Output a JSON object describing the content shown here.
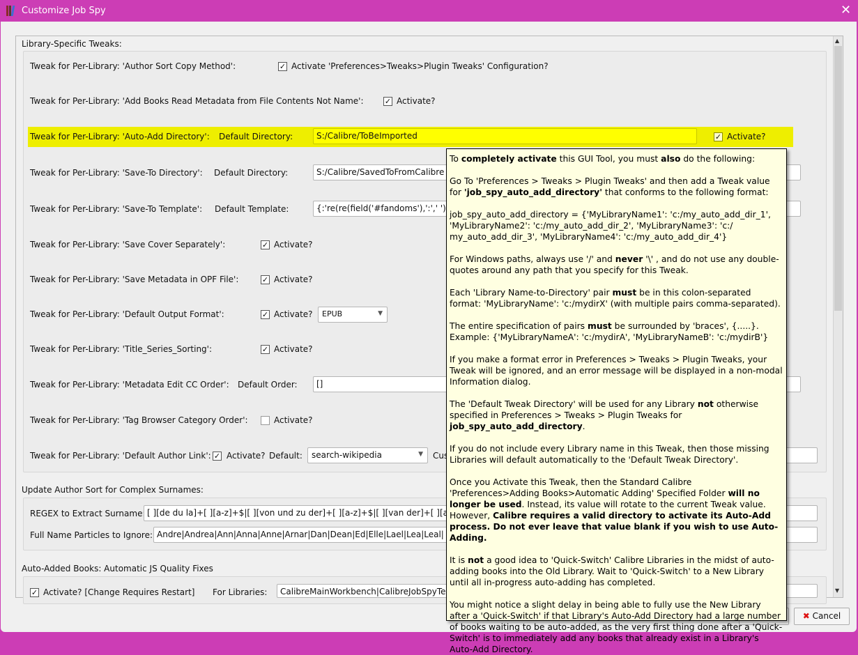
{
  "window": {
    "title": "Customize Job Spy",
    "close": "✕"
  },
  "sections": {
    "library": "Library-Specific Tweaks:",
    "author_sort": "Update Author Sort for Complex Surnames:",
    "auto_added": "Auto-Added Books: Automatic JS Quality Fixes"
  },
  "rows": {
    "author_sort_copy": {
      "label": "Tweak for Per-Library: 'Author Sort Copy Method':",
      "checkbox": "Activate 'Preferences>Tweaks>Plugin Tweaks' Configuration?",
      "checked": true
    },
    "read_metadata": {
      "label": "Tweak for Per-Library: 'Add Books Read Metadata from File Contents Not Name':",
      "checkbox": "Activate?",
      "checked": true
    },
    "auto_add": {
      "label": "Tweak for Per-Library: 'Auto-Add Directory':",
      "field_label": "Default Directory:",
      "value": "S:/Calibre/ToBeImported",
      "checkbox": "Activate?",
      "checked": true,
      "highlight": "#eeee00"
    },
    "save_to_dir": {
      "label": "Tweak for Per-Library: 'Save-To Directory':",
      "field_label": "Default Directory:",
      "value": "S:/Calibre/SavedToFromCalibre"
    },
    "save_to_template": {
      "label": "Tweak for Per-Library: 'Save-To Template':",
      "field_label": "Default Template:",
      "value": "{:'re(re(field('#fandoms'),':',' '),'"
    },
    "save_cover": {
      "label": "Tweak for Per-Library: 'Save Cover Separately':",
      "checkbox": "Activate?",
      "checked": true
    },
    "save_opf": {
      "label": "Tweak for Per-Library: 'Save Metadata in OPF File':",
      "checkbox": "Activate?",
      "checked": true
    },
    "output_format": {
      "label": "Tweak for Per-Library: 'Default Output Format':",
      "checkbox": "Activate?",
      "checked": true,
      "select": "EPUB"
    },
    "title_series": {
      "label": "Tweak for Per-Library: 'Title_Series_Sorting':",
      "checkbox": "Activate?",
      "checked": true
    },
    "cc_order": {
      "label": "Tweak for Per-Library: 'Metadata Edit CC Order':",
      "field_label": "Default Order:",
      "value": "[]"
    },
    "tag_browser": {
      "label": "Tweak for Per-Library: 'Tag Browser Category Order':",
      "checkbox": "Activate?",
      "checked": false
    },
    "author_link": {
      "label": "Tweak for Per-Library: 'Default Author Link':",
      "checkbox": "Activate?",
      "checked": true,
      "default_label": "Default:",
      "select": "search-wikipedia",
      "custom_label": "Cus"
    }
  },
  "surnames": {
    "regex_label": "REGEX to Extract Surname:",
    "regex_value": "[ ][de du la]+[ ][a-z]+$|[ ][von und zu der]+[ ][a-z]+$|[ ][van der]+[ ][a-z",
    "particles_label": "Full Name Particles to Ignore:",
    "particles_value": "Andre|Andrea|Ann|Anna|Anne|Arnar|Dan|Dean|Ed|Elle|Lael|Lea|Leal|"
  },
  "auto_fix": {
    "checkbox": "Activate?  [Change Requires Restart]",
    "checked": true,
    "libs_label": "For Libraries:",
    "libs_value": "CalibreMainWorkbench|CalibreJobSpyTest"
  },
  "buttons": {
    "cancel": "Cancel"
  },
  "tooltip": [
    [
      {
        "t": "To "
      },
      {
        "t": "completely activate",
        "b": true
      },
      {
        "t": " this GUI Tool, you must "
      },
      {
        "t": "also",
        "b": true
      },
      {
        "t": " do the following:"
      }
    ],
    [
      {
        "t": "Go To 'Preferences > Tweaks > Plugin Tweaks' and then add a Tweak value for "
      },
      {
        "t": "'job_spy_auto_add_directory'",
        "b": true
      },
      {
        "t": " that conforms to the following format:"
      }
    ],
    [
      {
        "t": "job_spy_auto_add_directory = {'MyLibraryName1': 'c:/my_auto_add_dir_1', 'MyLibraryName2': 'c:/my_auto_add_dir_2', 'MyLibraryName3': 'c:/ my_auto_add_dir_3', 'MyLibraryName4': 'c:/my_auto_add_dir_4'}"
      }
    ],
    [
      {
        "t": "For Windows paths, always use '/' and "
      },
      {
        "t": "never",
        "b": true
      },
      {
        "t": " '\\' , and do not use any double-quotes around any path that you specify for this Tweak."
      }
    ],
    [
      {
        "t": "Each 'Library Name-to-Directory' pair "
      },
      {
        "t": "must",
        "b": true
      },
      {
        "t": " be in this colon-separated format: 'MyLibraryName': 'c:/mydirX' (with multiple pairs comma-separated)."
      }
    ],
    [
      {
        "t": "The entire specification of pairs "
      },
      {
        "t": "must",
        "b": true
      },
      {
        "t": " be surrounded by 'braces', {.....}. Example: {'MyLibraryNameA': 'c:/mydirA', 'MyLibraryNameB': 'c:/mydirB'}"
      }
    ],
    [
      {
        "t": "If you make a format error in Preferences > Tweaks > Plugin Tweaks, your Tweak will be ignored, and an error message will be displayed in a non-modal Information dialog."
      }
    ],
    [
      {
        "t": "The 'Default Tweak Directory' will be used for any Library "
      },
      {
        "t": "not",
        "b": true
      },
      {
        "t": " otherwise specified in Preferences > Tweaks > Plugin Tweaks for "
      },
      {
        "t": "job_spy_auto_add_directory",
        "b": true
      },
      {
        "t": "."
      }
    ],
    [
      {
        "t": "If you do not include every Library name in this Tweak, then those missing Libraries will default automatically to the 'Default Tweak Directory'."
      }
    ],
    [
      {
        "t": "Once you Activate this Tweak, then the Standard Calibre 'Preferences>Adding Books>Automatic Adding' Specified Folder "
      },
      {
        "t": "will no longer be used",
        "b": true
      },
      {
        "t": ". Instead, its value will rotate to the current Tweak value. However, "
      },
      {
        "t": "Calibre requires a valid directory to activate its Auto-Add process. Do not ever leave that value blank if you wish to use Auto-Adding.",
        "b": true
      }
    ],
    [
      {
        "t": "It is "
      },
      {
        "t": "not",
        "b": true
      },
      {
        "t": " a good idea to 'Quick-Switch' Calibre Libraries in the midst of auto-adding books into the Old Library. Wait to 'Quick-Switch' to a New Library until all in-progress auto-adding has completed."
      }
    ],
    [
      {
        "t": "You might notice a slight delay in being able to fully use the New Library after a 'Quick-Switch' if that Library's Auto-Add Directory had a large number of books waiting to be auto-added, as the very first thing done after a 'Quick-Switch' is to immediately add any books that already exist in a Library's Auto-Add Directory."
      }
    ]
  ]
}
